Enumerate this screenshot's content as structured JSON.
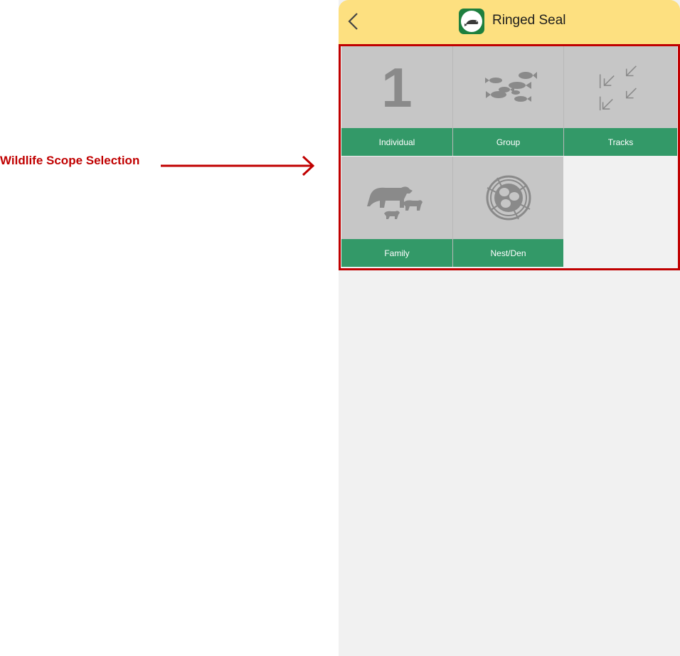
{
  "annotation": {
    "label": "Wildlife Scope Selection",
    "color": "#c00000"
  },
  "header": {
    "title": "Ringed Seal",
    "back_icon": "chevron-left-icon",
    "app_icon": "seal-icon",
    "background": "#fde080"
  },
  "scope_options": [
    {
      "label": "Individual",
      "icon": "number-one-icon",
      "glyph": "1"
    },
    {
      "label": "Group",
      "icon": "fish-group-icon"
    },
    {
      "label": "Tracks",
      "icon": "tracks-icon"
    },
    {
      "label": "Family",
      "icon": "bear-family-icon"
    },
    {
      "label": "Nest/Den",
      "icon": "nest-icon"
    }
  ],
  "colors": {
    "tile_bg": "#c6c6c6",
    "label_bar": "#339968",
    "icon_gray": "#8a8a8a",
    "highlight": "#c00000"
  }
}
